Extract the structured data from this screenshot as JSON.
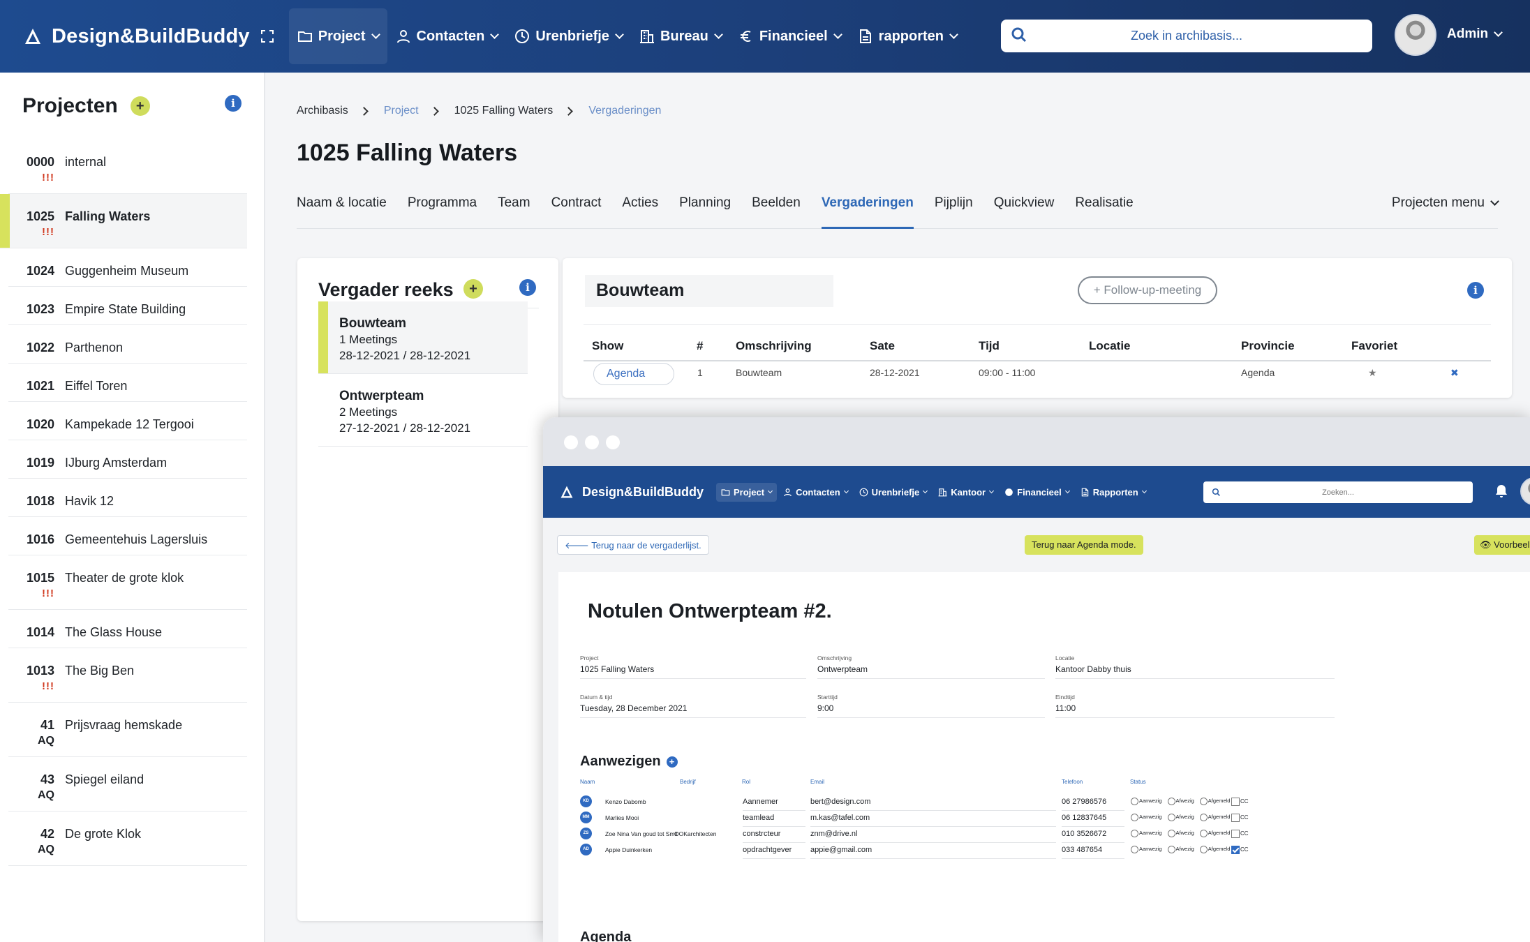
{
  "app": {
    "name": "Design&BuildBuddy",
    "brand_color": "#1e4b8f",
    "accent": "#d7e25d"
  },
  "nav": {
    "items": [
      {
        "label": "Project",
        "icon": "folder-icon"
      },
      {
        "label": "Contacten",
        "icon": "user-icon"
      },
      {
        "label": "Urenbriefje",
        "icon": "clock-icon"
      },
      {
        "label": "Bureau",
        "icon": "building-icon"
      },
      {
        "label": "Financieel",
        "icon": "euro-icon"
      },
      {
        "label": "rapporten",
        "icon": "document-icon"
      }
    ],
    "search_placeholder": "Zoek in archibasis...",
    "user": "Admin"
  },
  "sidebar": {
    "title": "Projecten",
    "projects": [
      {
        "num": "0000",
        "name": "internal",
        "sub": "!!!"
      },
      {
        "num": "1025",
        "name": "Falling Waters",
        "sub": "!!!"
      },
      {
        "num": "1024",
        "name": "Guggenheim Museum",
        "sub": ""
      },
      {
        "num": "1023",
        "name": "Empire State Building",
        "sub": ""
      },
      {
        "num": "1022",
        "name": "Parthenon",
        "sub": ""
      },
      {
        "num": "1021",
        "name": "Eiffel Toren",
        "sub": ""
      },
      {
        "num": "1020",
        "name": "Kampekade 12 Tergooi",
        "sub": ""
      },
      {
        "num": "1019",
        "name": "IJburg Amsterdam",
        "sub": ""
      },
      {
        "num": "1018",
        "name": "Havik 12",
        "sub": ""
      },
      {
        "num": "1016",
        "name": "Gemeentehuis Lagersluis",
        "sub": ""
      },
      {
        "num": "1015",
        "name": "Theater de grote klok",
        "sub": "!!!"
      },
      {
        "num": "1014",
        "name": "The Glass House",
        "sub": ""
      },
      {
        "num": "1013",
        "name": "The Big Ben",
        "sub": "!!!"
      },
      {
        "num": "41",
        "name": "Prijsvraag hemskade",
        "sub": "AQ"
      },
      {
        "num": "43",
        "name": "Spiegel eiland",
        "sub": "AQ"
      },
      {
        "num": "42",
        "name": "De grote Klok",
        "sub": "AQ"
      }
    ]
  },
  "breadcrumb": [
    "Archibasis",
    "Project",
    "1025 Falling Waters",
    "Vergaderingen"
  ],
  "page_title": "1025 Falling Waters",
  "tabs": [
    "Naam & locatie",
    "Programma",
    "Team",
    "Contract",
    "Acties",
    "Planning",
    "Beelden",
    "Vergaderingen",
    "Pijplijn",
    "Quickview",
    "Realisatie"
  ],
  "projecten_menu": "Projecten menu",
  "reeks": {
    "title": "Vergader reeks",
    "items": [
      {
        "name": "Bouwteam",
        "count": "1 Meetings",
        "dates": "28-12-2021 / 28-12-2021"
      },
      {
        "name": "Ontwerpteam",
        "count": "2 Meetings",
        "dates": "27-12-2021 / 28-12-2021"
      }
    ]
  },
  "meeting": {
    "name": "Bouwteam",
    "follow_up": "+ Follow-up-meeting",
    "columns": [
      "Show",
      "#",
      "Omschrijving",
      "Sate",
      "Tijd",
      "Locatie",
      "Provincie",
      "Favoriet"
    ],
    "row": {
      "show": "Agenda",
      "num": "1",
      "omschrijving": "Bouwteam",
      "sate": "28-12-2021",
      "tijd": "09:00 - 11:00",
      "provincie": "Agenda"
    }
  },
  "overlay": {
    "app_name": "Design&BuildBuddy",
    "nav": [
      "Project",
      "Contacten",
      "Urenbriefje",
      "Kantoor",
      "Financieel",
      "Rapporten"
    ],
    "search_placeholder": "Zoeken...",
    "back": "Terug naar de vergaderlijst.",
    "agenda_mode": "Terug naar Agenda mode.",
    "preview": "Voorbeel",
    "heading": "Notulen Ontwerpteam #2.",
    "fields": {
      "project_label": "Project",
      "project": "1025 Falling Waters",
      "omschrijving_label": "Omschrijving",
      "omschrijving": "Ontwerpteam",
      "locatie_label": "Locatie",
      "locatie": "Kantoor Dabby thuis",
      "datum_label": "Datum & tijd",
      "datum": "Tuesday, 28 December 2021",
      "start_label": "Starttijd",
      "start": "9:00",
      "eind_label": "Eindtijd",
      "eind": "11:00"
    },
    "aanwezigen_title": "Aanwezigen",
    "aanwezigen_cols": [
      "Naam",
      "Bedrijf",
      "Rol",
      "Email",
      "Telefoon",
      "Status"
    ],
    "status_options": [
      "Aanwezig",
      "Afwezig",
      "Afgemeld"
    ],
    "cc_label": "CC",
    "aanwezigen": [
      {
        "ini": "KD",
        "naam": "Kenzo Dabomb",
        "bedrijf": "",
        "rol": "Aannemer",
        "email": "bert@design.com",
        "tel": "06 27986576",
        "cc": false
      },
      {
        "ini": "MM",
        "naam": "Marlies Mooi",
        "bedrijf": "",
        "rol": "teamlead",
        "email": "m.kas@tafel.com",
        "tel": "06 12837645",
        "cc": false
      },
      {
        "ini": "ZS",
        "naam": "Zoe Nina Van goud tot Smit",
        "bedrijf": "OOKarchitecten",
        "rol": "constrcteur",
        "email": "znm@drive.nl",
        "tel": "010 3526672",
        "cc": false
      },
      {
        "ini": "AD",
        "naam": "Appie Duinkerken",
        "bedrijf": "",
        "rol": "opdrachtgever",
        "email": "appie@gmail.com",
        "tel": "033 487654",
        "cc": true
      }
    ],
    "agenda_title": "Agenda"
  }
}
